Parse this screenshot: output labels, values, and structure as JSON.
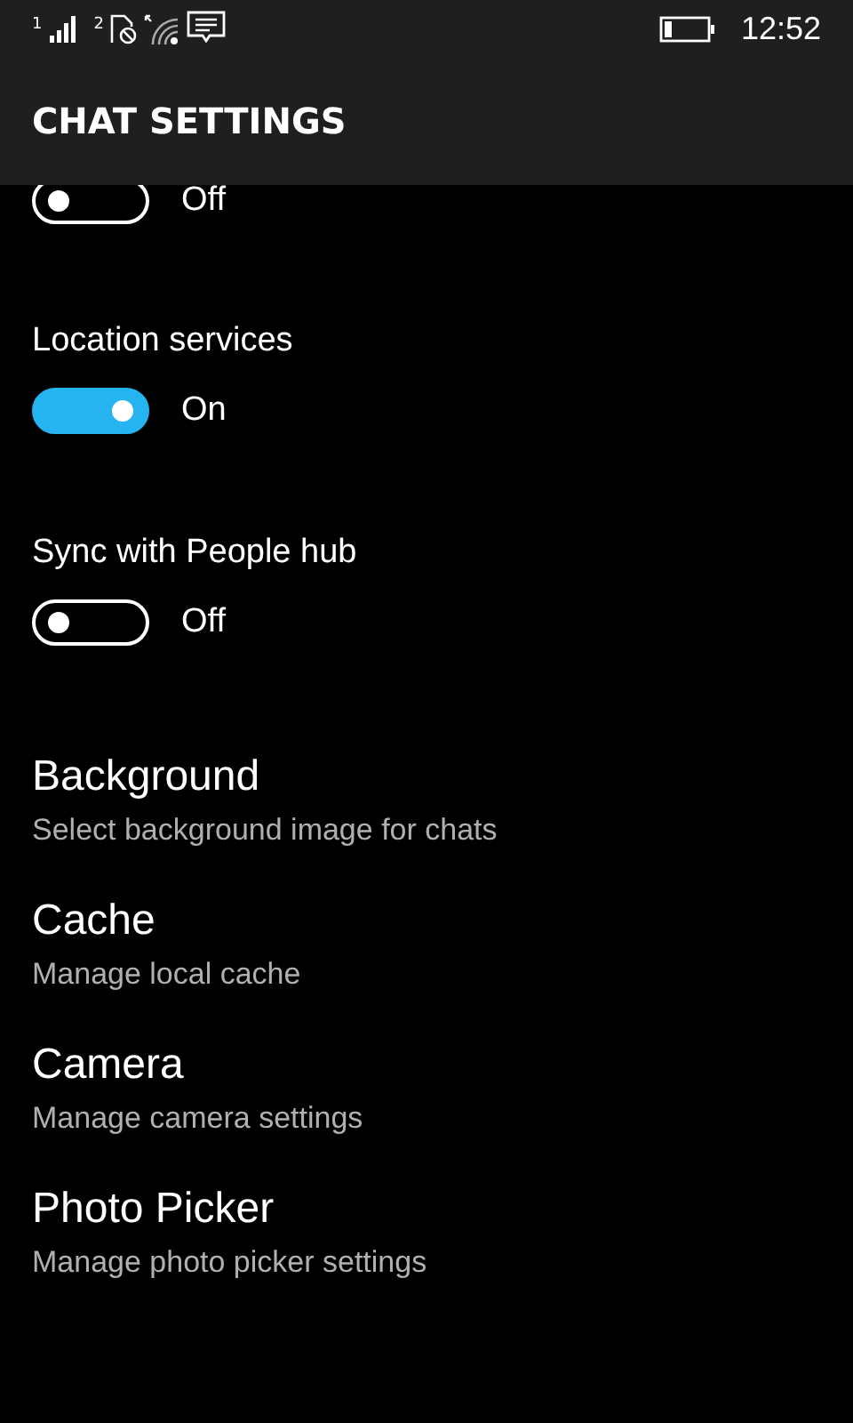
{
  "status_bar": {
    "sim1": "1",
    "sim2": "2",
    "time": "12:52"
  },
  "header": {
    "title": "CHAT SETTINGS"
  },
  "toggles": [
    {
      "state_text": "Off",
      "on": false
    },
    {
      "label": "Location services",
      "state_text": "On",
      "on": true
    },
    {
      "label": "Sync with People hub",
      "state_text": "Off",
      "on": false
    }
  ],
  "items": [
    {
      "title": "Background",
      "subtitle": "Select background image for chats"
    },
    {
      "title": "Cache",
      "subtitle": "Manage local cache"
    },
    {
      "title": "Camera",
      "subtitle": "Manage camera settings"
    },
    {
      "title": "Photo Picker",
      "subtitle": "Manage photo picker settings"
    }
  ]
}
